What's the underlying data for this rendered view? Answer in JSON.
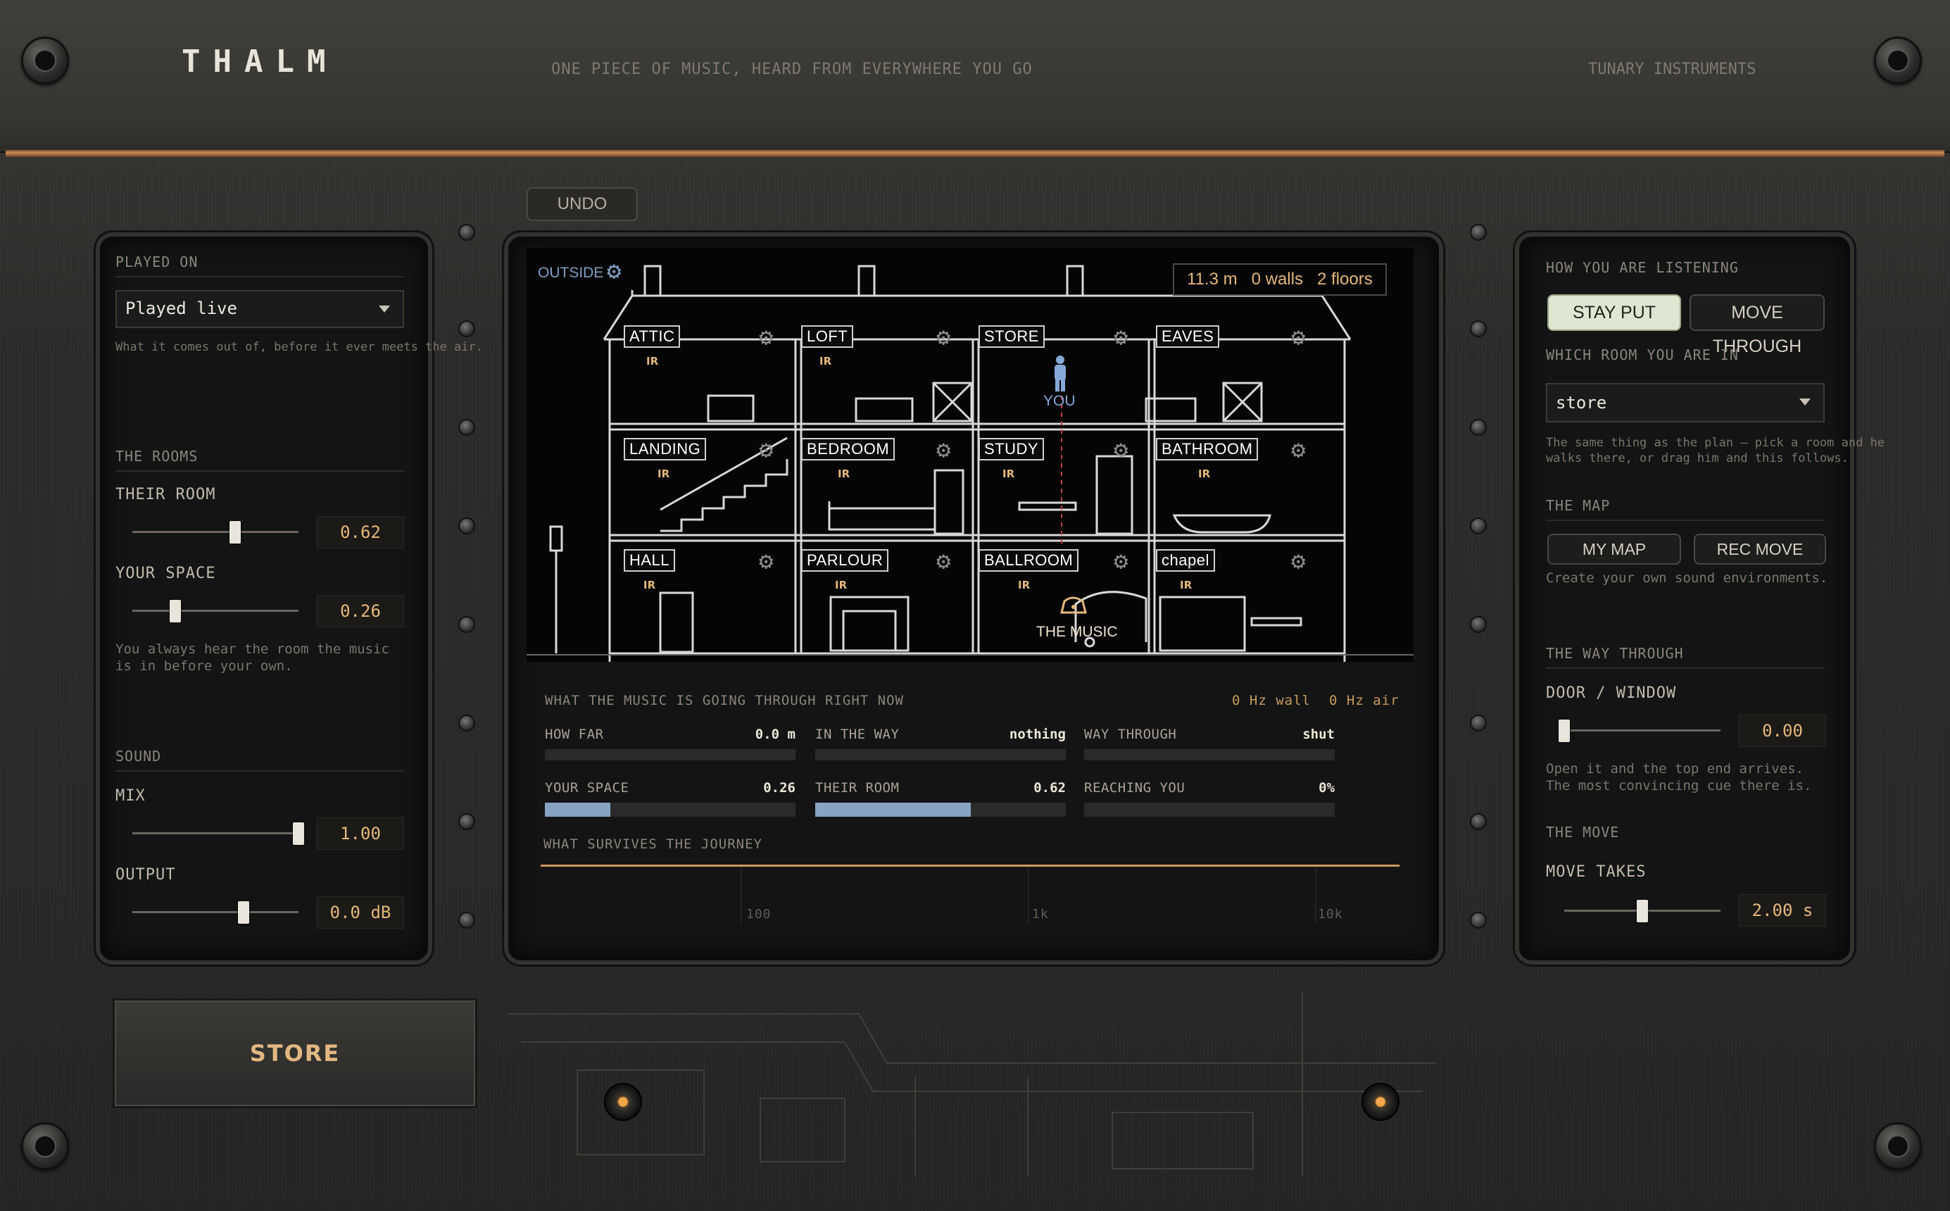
{
  "header": {
    "brand": "THALM",
    "tagline": "ONE PIECE OF MUSIC, HEARD FROM EVERYWHERE YOU GO",
    "maker": "TUNARY INSTRUMENTS"
  },
  "undo_label": "UNDO",
  "left": {
    "played_on": {
      "title": "PLAYED ON",
      "value": "Played live",
      "hint": "What it comes out of, before it ever meets the air."
    },
    "rooms": {
      "title": "THE ROOMS",
      "their_room": {
        "label": "THEIR ROOM",
        "value": "0.62",
        "level": 0.62
      },
      "your_space": {
        "label": "YOUR SPACE",
        "value": "0.26",
        "level": 0.26
      },
      "hint_line1": "You always hear the room the music",
      "hint_line2": "is in before your own."
    },
    "sound": {
      "title": "SOUND",
      "mix": {
        "label": "MIX",
        "value": "1.00",
        "level": 1.0
      },
      "output": {
        "label": "OUTPUT",
        "value": "0.0 dB",
        "level": 0.67
      }
    },
    "store_label": "STORE"
  },
  "center": {
    "outside_label": "OUTSIDE",
    "readout": {
      "distance": "11.3 m",
      "walls": "0 walls",
      "floors": "2 floors"
    },
    "rooms": [
      {
        "name": "ATTIC",
        "ir": "IR"
      },
      {
        "name": "LOFT",
        "ir": "IR"
      },
      {
        "name": "STORE",
        "ir": ""
      },
      {
        "name": "EAVES",
        "ir": ""
      },
      {
        "name": "LANDING",
        "ir": "IR"
      },
      {
        "name": "BEDROOM",
        "ir": "IR"
      },
      {
        "name": "STUDY",
        "ir": "IR"
      },
      {
        "name": "BATHROOM",
        "ir": "IR"
      },
      {
        "name": "HALL",
        "ir": "IR"
      },
      {
        "name": "PARLOUR",
        "ir": "IR"
      },
      {
        "name": "BALLROOM",
        "ir": "IR"
      },
      {
        "name": "chapel",
        "ir": "IR"
      }
    ],
    "you_label": "YOU",
    "music_label": "THE MUSIC",
    "journey": {
      "title": "WHAT THE MUSIC IS GOING THROUGH RIGHT NOW",
      "wall_hz": "0 Hz wall",
      "air_hz": "0 Hz air",
      "how_far": {
        "label": "HOW FAR",
        "value": "0.0 m",
        "level": 0
      },
      "in_the_way": {
        "label": "IN THE WAY",
        "value": "nothing",
        "level": 0
      },
      "way_through": {
        "label": "WAY THROUGH",
        "value": "shut",
        "level": 0
      },
      "your_space": {
        "label": "YOUR SPACE",
        "value": "0.26",
        "level": 0.26
      },
      "their_room": {
        "label": "THEIR ROOM",
        "value": "0.62",
        "level": 0.62
      },
      "reaching_you": {
        "label": "REACHING YOU",
        "value": "0%",
        "level": 0
      }
    },
    "survives": {
      "title": "WHAT SURVIVES THE JOURNEY",
      "ticks": [
        "100",
        "1k",
        "10k"
      ]
    }
  },
  "right": {
    "listening": {
      "title": "HOW YOU ARE LISTENING",
      "stay_put": "STAY PUT",
      "move_through": "MOVE THROUGH"
    },
    "which_room": {
      "title": "WHICH ROOM YOU ARE IN",
      "value": "store",
      "hint_line1": "The same thing as the plan – pick a room and he",
      "hint_line2": "walks there, or drag him and this follows."
    },
    "map": {
      "title": "THE MAP",
      "my_map": "MY MAP",
      "rec_move": "REC MOVE",
      "hint": "Create your own sound environments."
    },
    "way_through": {
      "title": "THE WAY THROUGH",
      "door": {
        "label": "DOOR / WINDOW",
        "value": "0.00",
        "level": 0.0
      },
      "hint_line1": "Open it and the top end arrives.",
      "hint_line2": "The most convincing cue there is."
    },
    "move": {
      "title": "THE MOVE",
      "label": "MOVE TAKES",
      "value": "2.00 s",
      "level": 0.5
    }
  },
  "colors": {
    "accent_amber": "#e5b87a",
    "meter_blue": "#86a3c4",
    "copper": "#c98a55"
  }
}
